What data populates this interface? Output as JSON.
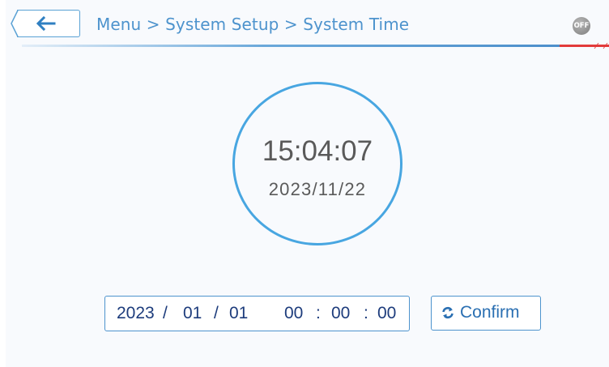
{
  "header": {
    "breadcrumb": "Menu > System Setup > System Time",
    "status_badge": "OFF",
    "back_icon": "left-arrow-icon"
  },
  "clock": {
    "time": "15:04:07",
    "date": "2023/11/22"
  },
  "datetime_input": {
    "year": "2023",
    "sep1": "/",
    "month": "01",
    "sep2": "/",
    "day": "01",
    "hour": "00",
    "sep3": ":",
    "minute": "00",
    "sep4": ":",
    "second": "00"
  },
  "confirm_button": {
    "label": "Confirm",
    "icon": "refresh-icon"
  },
  "colors": {
    "accent": "#4d93cd",
    "ring": "#48a6e1",
    "warning": "#e23a3a",
    "text_dark": "#1d3c7c"
  }
}
